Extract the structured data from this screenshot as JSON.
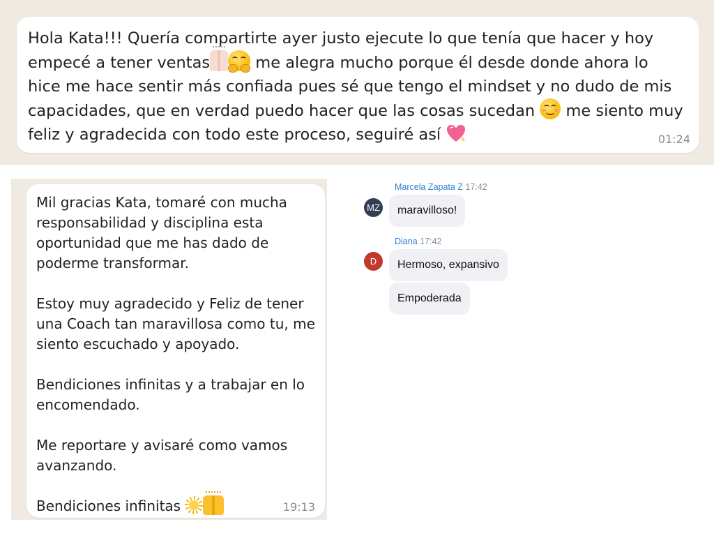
{
  "top_message": {
    "text_1": "Hola Kata!!! Quería compartirte ayer justo ejecute lo que tenía que hacer y hoy empecé a tener ventas",
    "text_2": " me alegra mucho porque él desde donde ahora lo hice me hace sentir más confiada pues sé que tengo el mindset y no dudo de mis capacidades, que en verdad puedo hacer que las cosas sucedan ",
    "text_3": " me siento muy feliz y agradecida con todo este proceso, seguiré así ",
    "time": "01:24",
    "emojis": [
      "raising-hands-icon",
      "hugging-face-icon",
      "smiling-face-icon",
      "sparkling-heart-icon"
    ]
  },
  "left_message": {
    "paragraphs": [
      "Mil gracias Kata, tomaré con mucha responsabilidad y disciplina esta oportunidad  que me has dado de poderme transformar.",
      "Estoy muy agradecido y Feliz de tener una Coach tan maravillosa como tu, me siento escuchado y apoyado.",
      "Bendiciones infinitas y a trabajar en lo encomendado.",
      "Me reportare y avisaré como vamos avanzando.",
      "Bendiciones infinitas "
    ],
    "time": "19:13",
    "emojis": [
      "sun-icon",
      "raising-hands-icon"
    ]
  },
  "chat": {
    "messages": [
      {
        "initials": "MZ",
        "name": "Marcela Zapata Z",
        "time": "17:42",
        "avatar_color": "#2f3e50",
        "bubbles": [
          "maravilloso!"
        ]
      },
      {
        "initials": "D",
        "name": "Diana",
        "time": "17:42",
        "avatar_color": "#c0392b",
        "bubbles": [
          "Hermoso, expansivo",
          "Empoderada"
        ]
      }
    ],
    "name_color": "#2b7cd3"
  },
  "colors": {
    "wallpaper": "#efeae2",
    "bubble": "#ffffff",
    "chat_bubble": "#f0f1f4"
  }
}
